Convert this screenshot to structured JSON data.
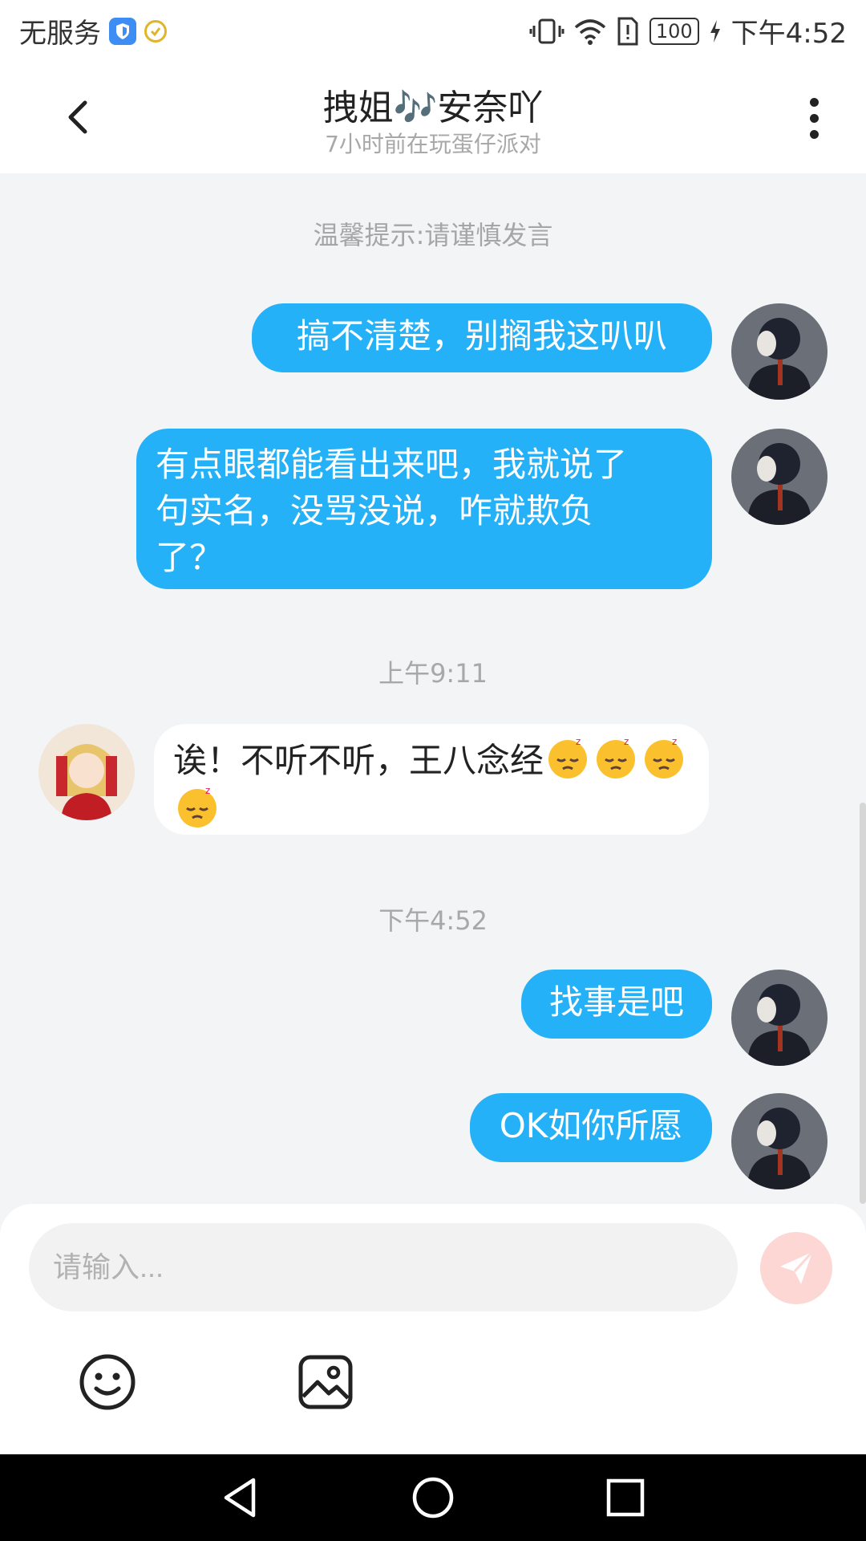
{
  "status_bar": {
    "carrier": "无服务",
    "battery": "100",
    "time": "下午4:52"
  },
  "header": {
    "title": "拽姐🎶安奈吖",
    "subtitle": "7小时前在玩蛋仔派对"
  },
  "chat": {
    "tip": "温馨提示:请谨慎发言",
    "messages": [
      {
        "side": "out",
        "text": "搞不清楚，别搁我这叭叭"
      },
      {
        "side": "out",
        "text_lines": [
          "有点眼都能看出来吧，我就说了",
          "句实名，没骂没说，咋就欺负",
          "了？"
        ]
      },
      {
        "side": "in",
        "text": "诶！不听不听，王八念经"
      },
      {
        "side": "out",
        "text": "找事是吧"
      },
      {
        "side": "out",
        "text": "OK如你所愿"
      }
    ],
    "timestamps": [
      "上午9:11",
      "下午4:52"
    ]
  },
  "input": {
    "placeholder": "请输入..."
  },
  "colors": {
    "outgoing_bubble": "#25b1f7",
    "incoming_bubble": "#ffffff",
    "send_button": "#fcd7d3",
    "background": "#f3f4f6"
  },
  "icons": {
    "back": "back-arrow-icon",
    "more": "more-vertical-icon",
    "send": "paper-plane-icon",
    "emoji": "smiley-icon",
    "image": "image-icon",
    "sleep_emoji": "sleeping-face-emoji"
  }
}
